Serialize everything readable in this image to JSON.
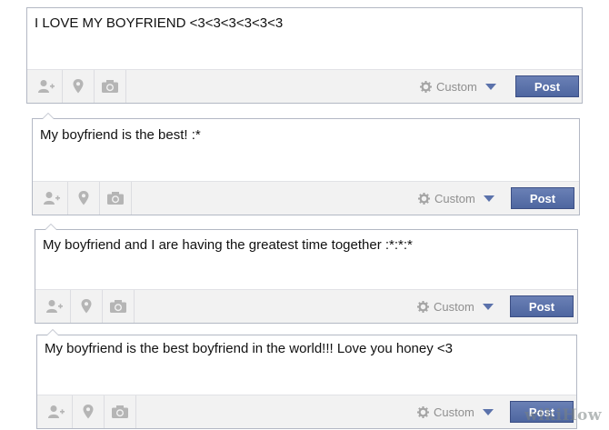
{
  "posts": [
    {
      "text": "I LOVE MY BOYFRIEND <3<3<3<3<3<3",
      "privacy": "Custom",
      "post_label": "Post"
    },
    {
      "text": "My boyfriend is the best! :*",
      "privacy": "Custom",
      "post_label": "Post"
    },
    {
      "text": "My boyfriend and I are having the greatest time together :*:*:*",
      "privacy": "Custom",
      "post_label": "Post"
    },
    {
      "text": "My boyfriend is the best boyfriend in the world!!! Love you honey <3",
      "privacy": "Custom",
      "post_label": "Post"
    }
  ],
  "icons": [
    "tag-friends-icon",
    "location-icon",
    "camera-icon",
    "gear-icon",
    "caret-down-icon"
  ],
  "colors": {
    "post_button": "#5b72ab",
    "toolbar": "#f2f2f2",
    "border": "#b3b8c4"
  },
  "watermark": "wikiHow"
}
